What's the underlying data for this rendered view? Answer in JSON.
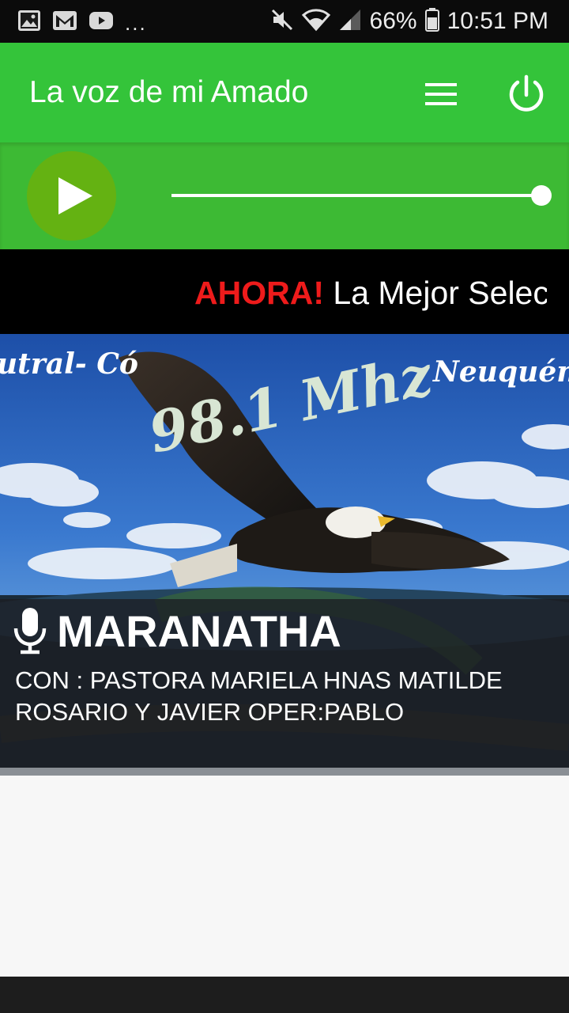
{
  "status_bar": {
    "left_icons": [
      "image-icon",
      "gmail-icon",
      "youtube-icon"
    ],
    "more": "...",
    "battery": "66%",
    "time": "10:51 PM"
  },
  "app_bar": {
    "title": "La voz de mi Amado",
    "menu_icon": "hamburger-menu-icon",
    "power_icon": "power-icon",
    "color": "#34c43a"
  },
  "player": {
    "state": "paused",
    "volume": 1.0,
    "accent": "#64b212"
  },
  "ticker": {
    "highlight": "AHORA!",
    "text": "La Mejor Selec"
  },
  "program": {
    "image_text_left": "utral- Có",
    "image_text_right": "Neuquén",
    "frequency": "98.1 Mhz",
    "title": "MARANATHA",
    "description": "CON : PASTORA MARIELA HNAS MATILDE ROSARIO Y JAVIER OPER:PABLO",
    "mic_icon": "microphone-icon"
  }
}
